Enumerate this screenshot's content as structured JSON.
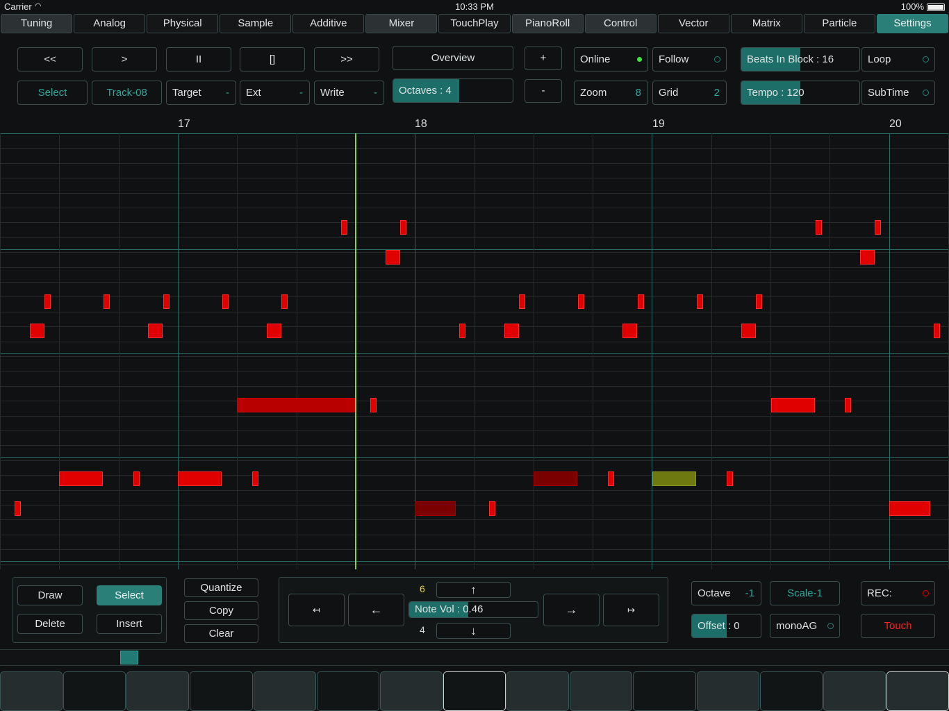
{
  "status": {
    "carrier": "Carrier",
    "time": "10:33 PM",
    "battery": "100%"
  },
  "tabs": [
    "Tuning",
    "Analog",
    "Physical",
    "Sample",
    "Additive",
    "Mixer",
    "TouchPlay",
    "PianoRoll",
    "Control",
    "Vector",
    "Matrix",
    "Particle",
    "Settings"
  ],
  "active_tab": "Settings",
  "transport": {
    "rewind": "<<",
    "play": ">",
    "pause": "II",
    "stop": "[]",
    "forward": ">>"
  },
  "overview": "Overview",
  "octaves": {
    "label": "Octaves : 4",
    "fill": 0.55
  },
  "plus": "+",
  "minus": "-",
  "row2": {
    "select": "Select",
    "track": "Track-08",
    "target": "Target",
    "target_val": "-",
    "ext": "Ext",
    "ext_val": "-",
    "write": "Write",
    "write_val": "-"
  },
  "online": "Online",
  "follow": "Follow",
  "zoom": {
    "label": "Zoom",
    "value": "8"
  },
  "grid": {
    "label": "Grid",
    "value": "2"
  },
  "beats": {
    "label": "Beats In Block : 16",
    "fill": 0.5
  },
  "loop": "Loop",
  "tempo": {
    "label": "Tempo : 120",
    "fill": 0.5
  },
  "subtime": "SubTime",
  "ruler": [
    "17",
    "18",
    "19",
    "20"
  ],
  "edit": {
    "draw": "Draw",
    "select": "Select",
    "delete": "Delete",
    "insert": "Insert"
  },
  "ops": {
    "quantize": "Quantize",
    "copy": "Copy",
    "clear": "Clear"
  },
  "nav": {
    "far_left": "↤",
    "left": "←",
    "up": "↑",
    "down": "↓",
    "right": "→",
    "far_right": "↦",
    "upper_num": "6",
    "lower_num": "4",
    "note_vol": "Note Vol : 0.46",
    "note_vol_fill": 0.46
  },
  "octave": {
    "label": "Octave",
    "value": "-1"
  },
  "scale": "Scale-1",
  "rec": "REC:",
  "offset": {
    "label": "Offset : 0",
    "fill": 0.5
  },
  "mono": "monoAG",
  "touch": "Touch",
  "colors": {
    "accent": "#2a8079",
    "note": "#e00000",
    "playhead": "#8fd14f",
    "online": "#3ce63c",
    "rec": "#e00000"
  }
}
